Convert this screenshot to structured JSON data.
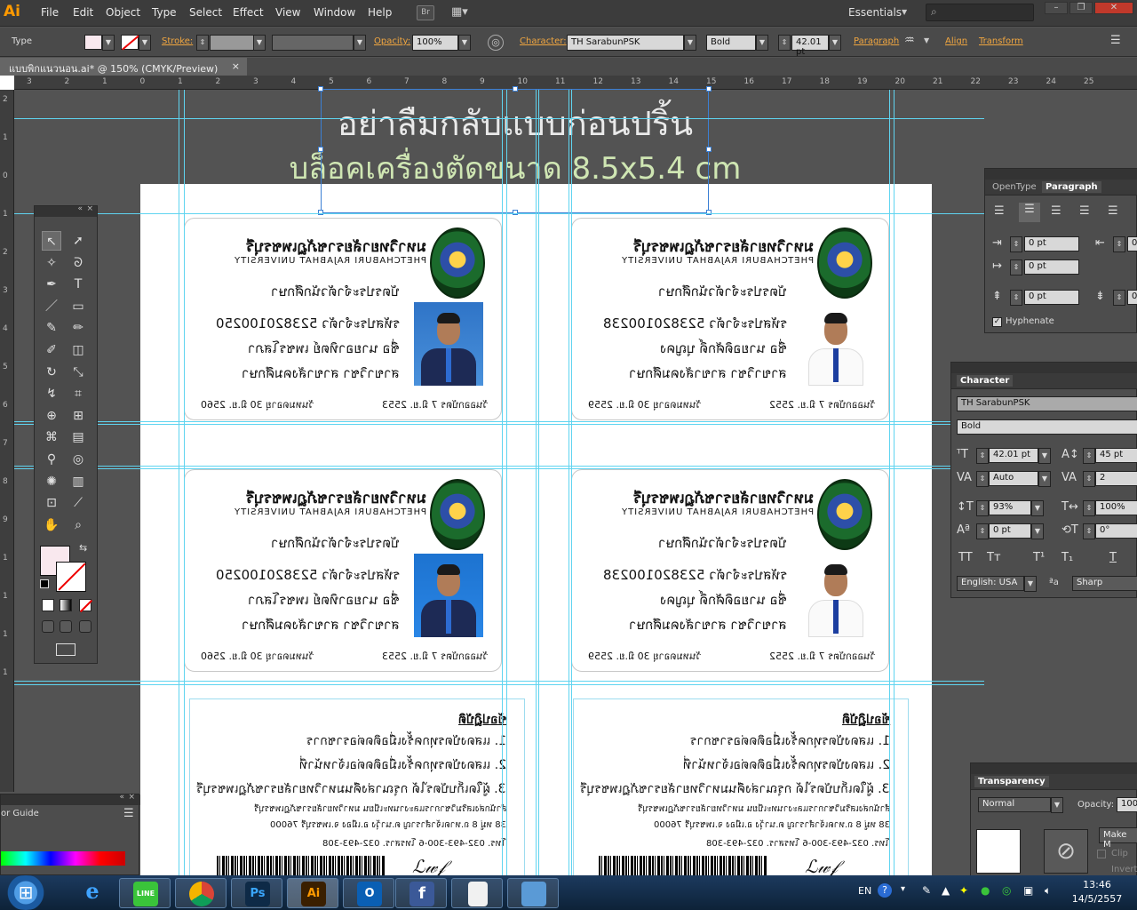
{
  "app": {
    "logo": "Ai",
    "menus": [
      "File",
      "Edit",
      "Object",
      "Type",
      "Select",
      "Effect",
      "View",
      "Window",
      "Help"
    ],
    "bridge_label": "Br",
    "workspace": "Essentials",
    "search_placeholder": ""
  },
  "control_bar": {
    "mode": "Type",
    "stroke_label": "Stroke:",
    "opacity_label": "Opacity:",
    "opacity_value": "100%",
    "character_label": "Character:",
    "font": "TH SarabunPSK",
    "style": "Bold",
    "size": "42.01 pt",
    "paragraph_label": "Paragraph",
    "align_label": "Align",
    "transform_label": "Transform"
  },
  "document_tab": {
    "title": "แบบพิกแนวนอน.ai* @ 150% (CMYK/Preview)",
    "close": "×"
  },
  "ruler": {
    "h": [
      "3",
      "2",
      "1",
      "0",
      "1",
      "2",
      "3",
      "4",
      "5",
      "6",
      "7",
      "8",
      "9",
      "10",
      "11",
      "12",
      "13",
      "14",
      "15",
      "16",
      "17",
      "18",
      "19",
      "20",
      "21",
      "22",
      "23",
      "24",
      "25"
    ],
    "v": [
      "2",
      "1",
      "0",
      "1",
      "2",
      "3",
      "4",
      "5",
      "6",
      "7",
      "8",
      "9",
      "1",
      "1",
      "1",
      "1"
    ]
  },
  "canvas": {
    "headline": "อย่าลืมกลับแบบก่อนปริ้น",
    "subheadline": "บล็อคเครื่องตัดขนาด 8.5x5.4 cm"
  },
  "cards": [
    {
      "uni": "มหาวิทยาลัยราชภัฏเพชรบุรี",
      "uni_en": "PHETCHABURI RAJABHAT UNIVERSITY",
      "title": "บัตรประจำตัวนักศึกษา",
      "id": "รหัสประจำตัว  523820100250",
      "name": "ชื่อ นายอาทิตย์  เพชรโสภา",
      "major": "สาขาวิชา  สาขาสังคมศึกษา",
      "issue": "วันออกบัตร 7 มิ.ย. 2553",
      "expire": "วันหมดอายุ 30 มิ.ย. 2560",
      "photo": "blue"
    },
    {
      "uni": "มหาวิทยาลัยราชภัฏเพชรบุรี",
      "uni_en": "PHETCHABURI RAJABHAT UNIVERSITY",
      "title": "บัตรประจำตัวนักศึกษา",
      "id": "รหัสประจำตัว  523820100238",
      "name": "ชื่อ นายอดิศักดิ์  บุญคง",
      "major": "สาขาวิชา  สาขาสังคมศึกษา",
      "issue": "วันออกบัตร 7 มิ.ย. 2552",
      "expire": "วันหมดอายุ 30 มิ.ย. 2559",
      "photo": "white"
    },
    {
      "uni": "มหาวิทยาลัยราชภัฏเพชรบุรี",
      "uni_en": "PHETCHABURI RAJABHAT UNIVERSITY",
      "title": "บัตรประจำตัวนักศึกษา",
      "id": "รหัสประจำตัว  523820100250",
      "name": "ชื่อ นายอาทิตย์  เพชรโสภา",
      "major": "สาขาวิชา  สาขาสังคมศึกษา",
      "issue": "วันออกบัตร 7 มิ.ย. 2553",
      "expire": "วันหมดอายุ 30 มิ.ย. 2560",
      "photo": "blue"
    },
    {
      "uni": "มหาวิทยาลัยราชภัฏเพชรบุรี",
      "uni_en": "PHETCHABURI RAJABHAT UNIVERSITY",
      "title": "บัตรประจำตัวนักศึกษา",
      "id": "รหัสประจำตัว  523820100238",
      "name": "ชื่อ นายอดิศักดิ์  บุญคง",
      "major": "สาขาวิชา  สาขาสังคมศึกษา",
      "issue": "วันออกบัตร 7 มิ.ย. 2552",
      "expire": "วันหมดอายุ 30 มิ.ย. 2559",
      "photo": "white"
    }
  ],
  "back": {
    "title": "ข้อปฏิบัติ",
    "rule1": "1. แสดงบัตรทุกครั้งเมื่อติดต่อราชการ",
    "rule2": "2. แสดงบัตรทุกครั้งเมื่อติดต่อเจ้าหน้าที่",
    "rule3": "3. ผู้ใดเก็บบัตรได้ กรุณาส่งคืนมหาวิทยาลัยราชภัฏเพชรบุรี",
    "office": "สำนักส่งเสริมวิชาการและงานทะเบียน มหาวิทยาลัยราชภัฏเพชรบุรี",
    "address": "38 หมู่ 8 ถ.หาดเจ้าสำราญ ต.นาวุ้ง อ.เมือง จ.เพชรบุรี 76000",
    "tel": "โทร. 032-493-300-6 โทรสาร. 032-493-308"
  },
  "opentype_panel": {
    "tab1": "OpenType",
    "tab2": "Paragraph",
    "indent_left": "0 pt",
    "indent_first": "0 pt",
    "space_before": "0 pt",
    "right_indent": "0",
    "space_after": "0",
    "hyphenate": "Hyphenate"
  },
  "character_panel": {
    "title": "Character",
    "font": "TH SarabunPSK",
    "style": "Bold",
    "size": "42.01 pt",
    "leading": "45 pt",
    "kerning": "Auto",
    "tracking": "2",
    "vscale": "93%",
    "hscale": "100%",
    "baseline": "0 pt",
    "rotate": "0°",
    "tt": [
      "TT",
      "Tт",
      "T¹",
      "T₁",
      "T"
    ],
    "language": "English: USA",
    "aa_label": "ªa",
    "aa": "Sharp"
  },
  "transparency_panel": {
    "title": "Transparency",
    "mode": "Normal",
    "opacity_label": "Opacity:",
    "opacity": "100%",
    "make_mask": "Make M",
    "clip": "Clip",
    "invert": "Invert"
  },
  "color_guide": {
    "title": "or Guide"
  },
  "taskbar": {
    "lang": "EN",
    "time": "13:46",
    "date": "14/5/2557",
    "apps": [
      "LINE",
      "",
      "Ps",
      "Ai",
      "O",
      "f",
      "",
      ""
    ]
  }
}
